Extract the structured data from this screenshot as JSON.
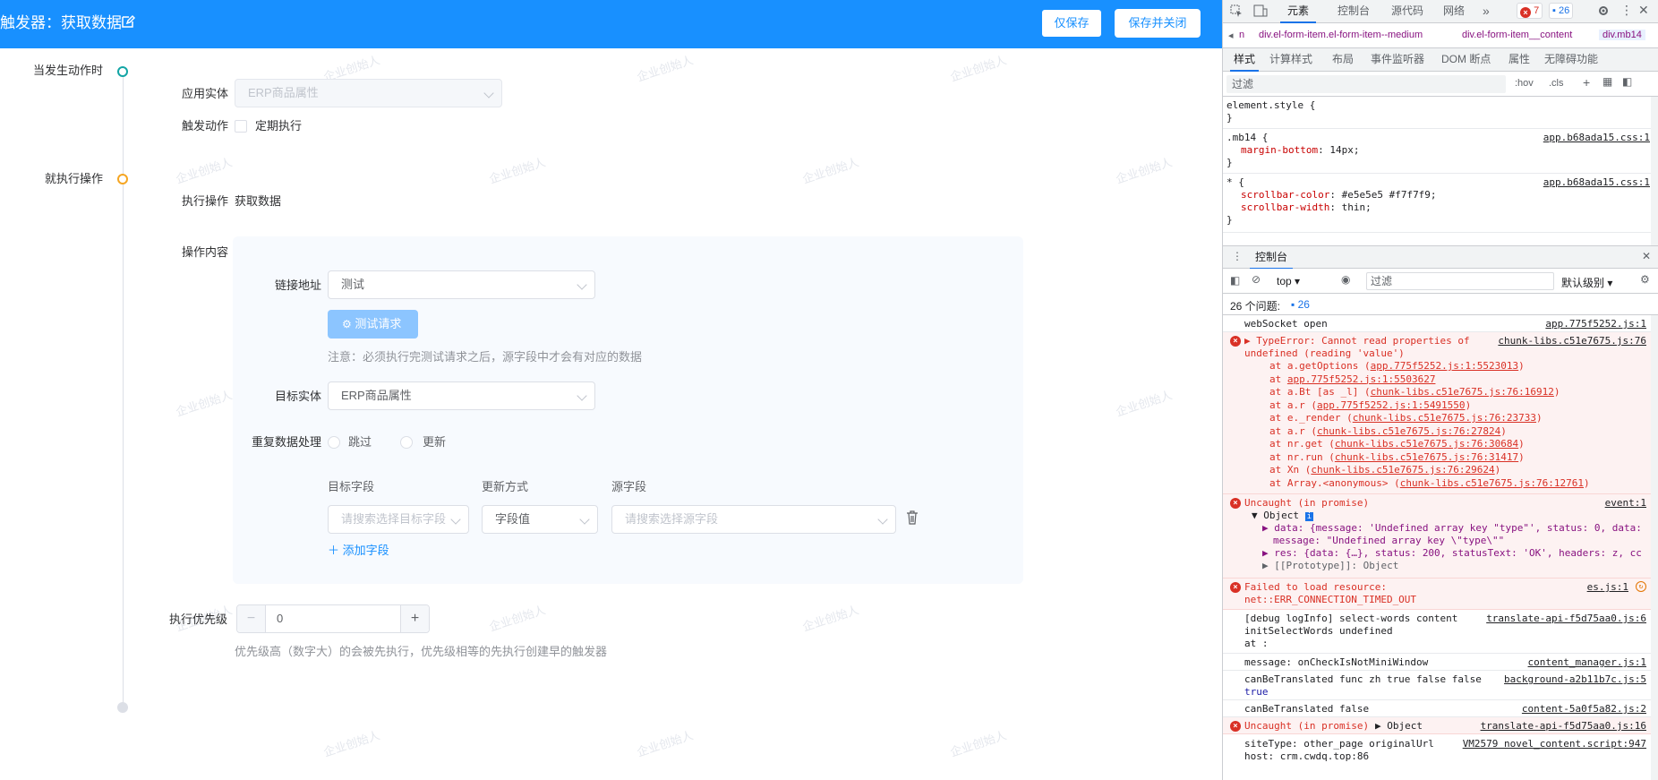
{
  "header": {
    "title": "触发器：获取数据",
    "save_only": "仅保存",
    "save_close": "保存并关闭"
  },
  "watermark": "企业创始人",
  "timeline": {
    "when_label": "当发生动作时",
    "then_label": "就执行操作"
  },
  "trigger": {
    "entity_label": "应用实体",
    "entity_value": "ERP商品属性",
    "action_label": "触发动作",
    "scheduled_label": "定期执行"
  },
  "operation": {
    "exec_label": "执行操作",
    "exec_value": "获取数据",
    "content_label": "操作内容",
    "url_label": "链接地址",
    "url_value": "测试",
    "test_button": "测试请求",
    "notice": "注意：必须执行完测试请求之后，源字段中才会有对应的数据",
    "target_entity_label": "目标实体",
    "target_entity_value": "ERP商品属性",
    "dup_label": "重复数据处理",
    "dup_skip": "跳过",
    "dup_update": "更新",
    "col_target": "目标字段",
    "col_method": "更新方式",
    "col_source": "源字段",
    "target_placeholder": "请搜索选择目标字段",
    "method_value": "字段值",
    "source_placeholder": "请搜索选择源字段",
    "add_field": "添加字段"
  },
  "priority": {
    "label": "执行优先级",
    "minus": "−",
    "value": "0",
    "plus": "+",
    "hint": "优先级高（数字大）的会被先执行，优先级相等的先执行创建早的触发器"
  },
  "devtools": {
    "tabs": [
      "元素",
      "控制台",
      "源代码",
      "网络"
    ],
    "more": "»",
    "error_count": "7",
    "msg_count": "26",
    "breadcrumbs": [
      "n",
      "div.el-form-item.el-form-item--medium",
      "div.el-form-item__content",
      "div.mb14"
    ],
    "subtabs": [
      "样式",
      "计算样式",
      "布局",
      "事件监听器",
      "DOM 断点",
      "属性",
      "无障碍功能"
    ],
    "filter_placeholder": "过滤",
    "hov": ":hov",
    "cls": ".cls",
    "rules": [
      {
        "selector": "element.style {",
        "lines": [],
        "close": "}",
        "source": ""
      },
      {
        "selector": ".mb14 {",
        "lines": [
          {
            "prop": "margin-bottom",
            "value": "14px;"
          }
        ],
        "close": "}",
        "source": "app.b68ada15.css:1"
      },
      {
        "selector": "* {",
        "lines": [
          {
            "prop": "scrollbar-color",
            "value": "#e5e5e5 #f7f7f9;"
          },
          {
            "prop": "scrollbar-width",
            "value": "thin;"
          }
        ],
        "close": "}",
        "source": "app.b68ada15.css:1"
      }
    ],
    "console_tab": "控制台",
    "context": "top",
    "console_filter": "过滤",
    "level": "默认级别",
    "issues": "26 个问题:",
    "issues_count": "26",
    "messages": {
      "m1": {
        "text": "webSocket open",
        "source": "app.775f5252.js:1"
      },
      "m2": {
        "text1": "TypeError: Cannot read properties of",
        "text2": "undefined (reading 'value')",
        "source": "chunk-libs.c51e7675.js:76",
        "stack": [
          {
            "pre": "at a.getOptions (",
            "link": "app.775f5252.js:1:5523013",
            "post": ")"
          },
          {
            "pre": "at ",
            "link": "app.775f5252.js:1:5503627",
            "post": ""
          },
          {
            "pre": "at a.Bt [as _l] (",
            "link": "chunk-libs.c51e7675.js:76:16912",
            "post": ")"
          },
          {
            "pre": "at a.r (",
            "link": "app.775f5252.js:1:5491550",
            "post": ")"
          },
          {
            "pre": "at e._render (",
            "link": "chunk-libs.c51e7675.js:76:23733",
            "post": ")"
          },
          {
            "pre": "at a.r (",
            "link": "chunk-libs.c51e7675.js:76:27824",
            "post": ")"
          },
          {
            "pre": "at nr.get (",
            "link": "chunk-libs.c51e7675.js:76:30684",
            "post": ")"
          },
          {
            "pre": "at nr.run (",
            "link": "chunk-libs.c51e7675.js:76:31417",
            "post": ")"
          },
          {
            "pre": "at Xn (",
            "link": "chunk-libs.c51e7675.js:76:29624",
            "post": ")"
          },
          {
            "pre": "at Array.<anonymous> (",
            "link": "chunk-libs.c51e7675.js:76:12761",
            "post": ")"
          }
        ]
      },
      "m3": {
        "text": "Uncaught (in promise)",
        "source": "event:1",
        "obj": "Object",
        "data": "data: {message: 'Undefined array key \"type\"', status: 0, data:",
        "message": "message: \"Undefined array key \\\"type\\\"\"",
        "res": "res: {data: {…}, status: 200, statusText: 'OK', headers: z, cc",
        "proto": "[[Prototype]]: Object"
      },
      "m4": {
        "text1": "Failed to load resource:",
        "text2": "net::ERR_CONNECTION_TIMED_OUT",
        "source": "es.js:1"
      },
      "m5": {
        "text1": "[debug logInfo] select-words content",
        "text2": "initSelectWords undefined",
        "text3": "at  :",
        "source": "translate-api-f5d75aa0.js:6"
      },
      "m6": {
        "text": "message: onCheckIsNotMiniWindow",
        "source": "content_manager.js:1"
      },
      "m7": {
        "text1": "canBeTranslated func zh true false false",
        "text2": "true",
        "source": "background-a2b11b7c.js:5"
      },
      "m8": {
        "text": "canBeTranslated false",
        "source": "content-5a0f5a82.js:2"
      },
      "m9": {
        "text": "Uncaught (in promise)",
        "obj": "▶ Object",
        "source": "translate-api-f5d75aa0.js:16"
      },
      "m10": {
        "text1": "siteType: other_page originalUrl",
        "text2": "host: crm.cwdq.top:86",
        "source": "VM2579 novel_content.script:947"
      }
    }
  }
}
